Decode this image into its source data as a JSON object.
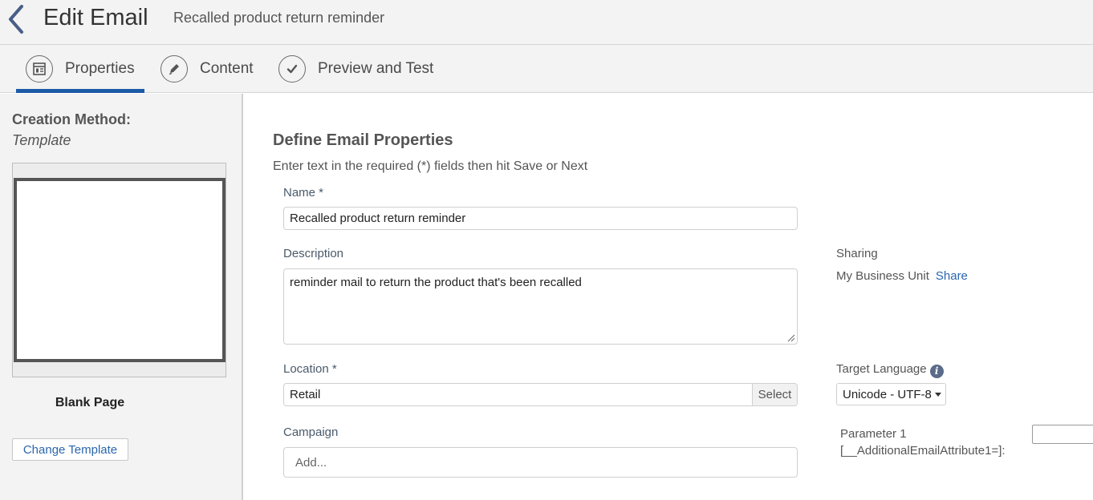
{
  "header": {
    "title": "Edit Email",
    "subtitle": "Recalled product return reminder"
  },
  "tabs": [
    {
      "label": "Properties",
      "icon": "properties-icon",
      "active": true
    },
    {
      "label": "Content",
      "icon": "pencil-icon",
      "active": false
    },
    {
      "label": "Preview and Test",
      "icon": "checkmark-icon",
      "active": false
    }
  ],
  "sidebar": {
    "creation_method_label": "Creation Method:",
    "creation_method_value": "Template",
    "template_name": "Blank Page",
    "change_template_label": "Change Template"
  },
  "form": {
    "title": "Define Email Properties",
    "hint": "Enter text in the required (*) fields then hit Save or Next",
    "name_label": "Name *",
    "name_value": "Recalled product return reminder",
    "description_label": "Description",
    "description_value": "reminder mail to return the product that's been recalled",
    "location_label": "Location *",
    "location_value": "Retail",
    "location_select_label": "Select",
    "campaign_label": "Campaign",
    "campaign_placeholder": "Add..."
  },
  "side": {
    "sharing_label": "Sharing",
    "sharing_value": "My Business Unit",
    "share_link": "Share",
    "target_language_label": "Target Language",
    "target_language_value": "Unicode - UTF-8",
    "parameter_label_1": "Parameter 1",
    "parameter_label_2": "[__AdditionalEmailAttribute1=]:",
    "parameter_value": ""
  },
  "colors": {
    "accent": "#1b5aa6",
    "link": "#2a66ad",
    "panel_bg": "#f3f3f3"
  }
}
